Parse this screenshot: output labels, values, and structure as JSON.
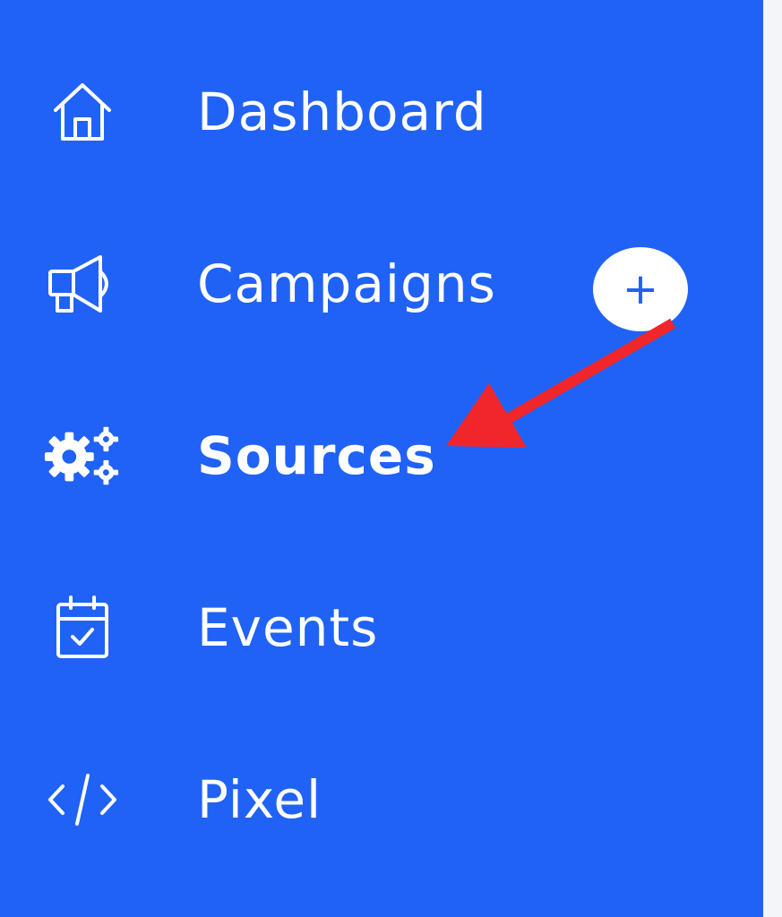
{
  "sidebar": {
    "items": [
      {
        "label": "Dashboard",
        "icon": "home-icon",
        "active": false
      },
      {
        "label": "Campaigns",
        "icon": "megaphone-icon",
        "active": false
      },
      {
        "label": "Sources",
        "icon": "gears-icon",
        "active": true
      },
      {
        "label": "Events",
        "icon": "calendar-check-icon",
        "active": false
      },
      {
        "label": "Pixel",
        "icon": "code-icon",
        "active": false
      }
    ],
    "add_campaign_label": "+"
  },
  "annotation": {
    "type": "arrow",
    "color": "#f0262a",
    "points_to": "Sources"
  },
  "colors": {
    "sidebar_bg": "#2062f6",
    "page_bg": "#f4f5f9",
    "text": "#ffffff",
    "accent_plus": "#2062f6"
  }
}
